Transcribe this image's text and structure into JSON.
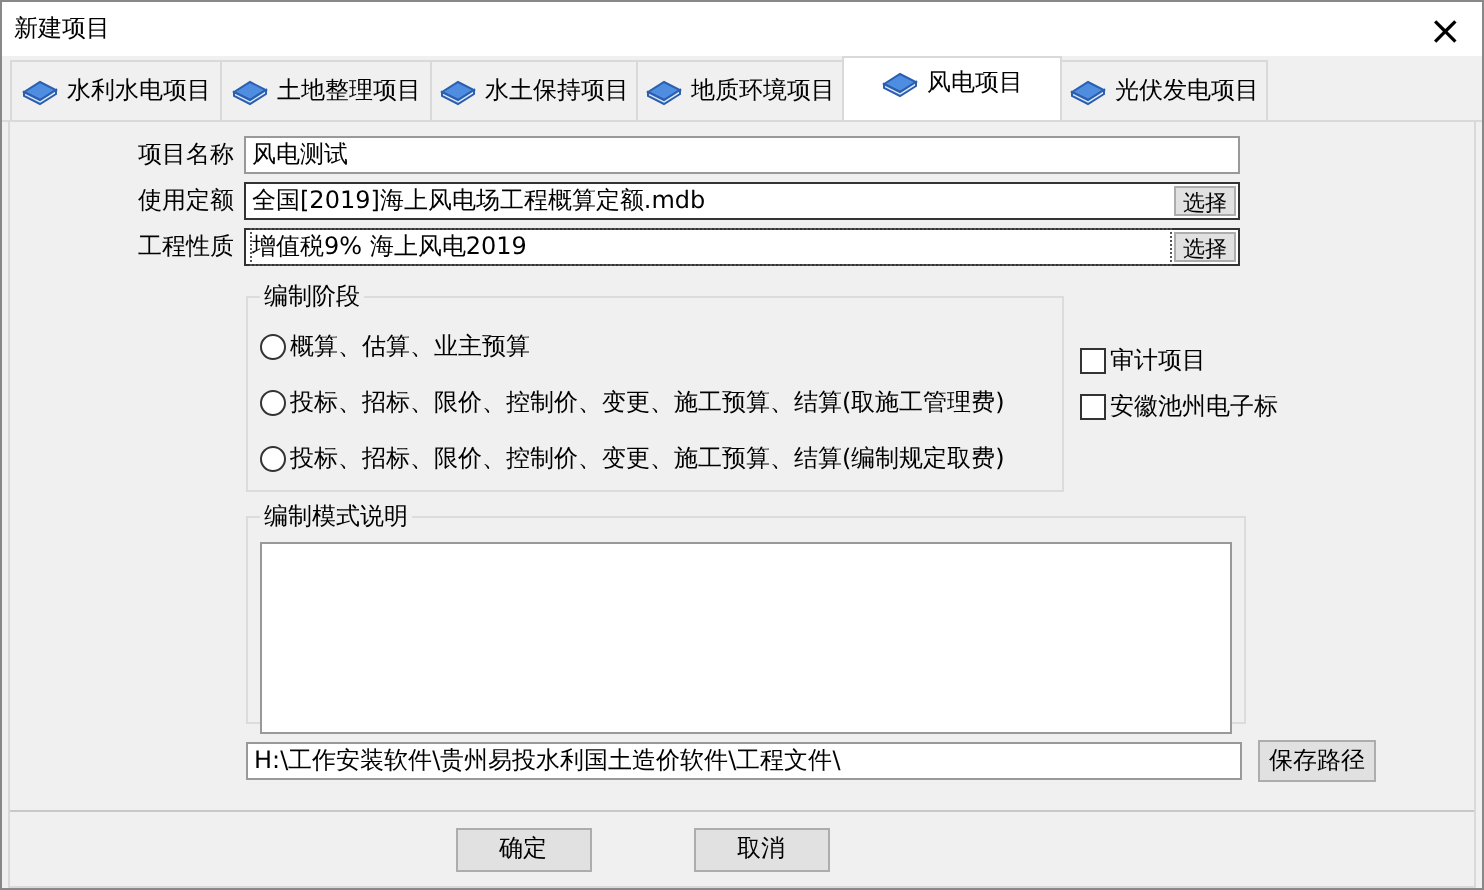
{
  "window": {
    "title": "新建项目",
    "close": "×"
  },
  "tabs": [
    {
      "label": "水利水电项目",
      "selected": false
    },
    {
      "label": "土地整理项目",
      "selected": false
    },
    {
      "label": "水土保持项目",
      "selected": false
    },
    {
      "label": "地质环境项目",
      "selected": false
    },
    {
      "label": "风电项目",
      "selected": true
    },
    {
      "label": "光伏发电项目",
      "selected": false
    }
  ],
  "fields": [
    {
      "label": "项目名称",
      "value": "风电测试",
      "kind": "text"
    },
    {
      "label": "使用定额",
      "value": "全国[2019]海上风电场工程概算定额.mdb",
      "kind": "picker",
      "button": "选择"
    },
    {
      "label": "工程性质",
      "value": "增值税9%  海上风电2019",
      "kind": "picker",
      "button": "选择",
      "focused": true
    }
  ],
  "stage": {
    "title": "编制阶段",
    "options": [
      {
        "label": "概算、估算、业主预算",
        "selected": false
      },
      {
        "label": "投标、招标、限价、控制价、变更、施工预算、结算(取施工管理费)",
        "selected": false
      },
      {
        "label": "投标、招标、限价、控制价、变更、施工预算、结算(编制规定取费)",
        "selected": false
      }
    ]
  },
  "checks": [
    {
      "label": "审计项目",
      "checked": false
    },
    {
      "label": "安徽池州电子标",
      "checked": false
    }
  ],
  "description": {
    "title": "编制模式说明"
  },
  "path": {
    "value": "H:\\工作安装软件\\贵州易投水利国土造价软件\\工程文件\\",
    "button": "保存路径"
  },
  "buttons": [
    "确定",
    "取消"
  ]
}
